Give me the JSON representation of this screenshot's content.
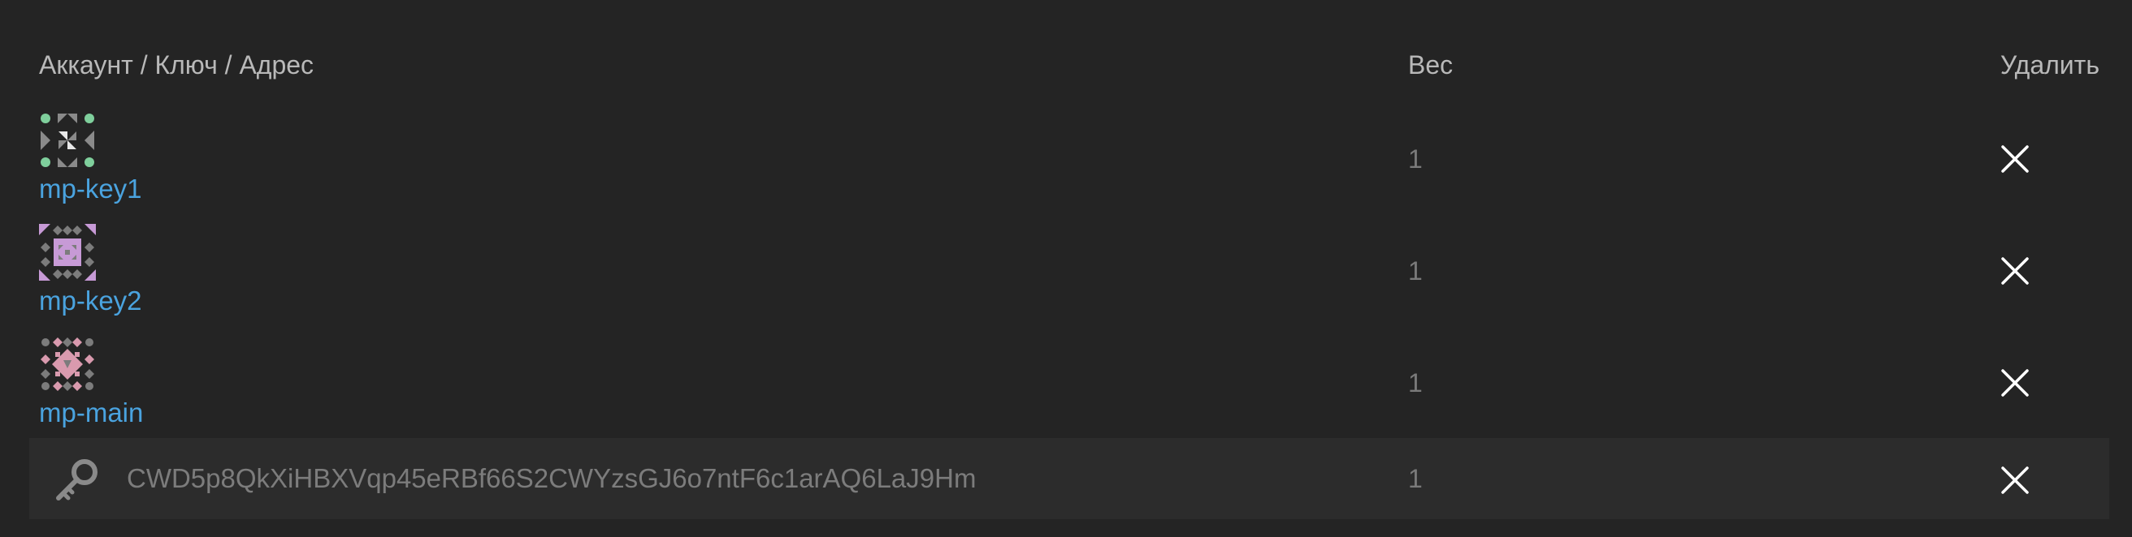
{
  "header": {
    "account_label": "Аккаунт / Ключ / Адрес",
    "weight_label": "Вес",
    "delete_label": "Удалить"
  },
  "accounts": [
    {
      "name": "mp-key1",
      "weight": "1",
      "avatar_icon": "identicon-green-gray"
    },
    {
      "name": "mp-key2",
      "weight": "1",
      "avatar_icon": "identicon-purple-gray"
    },
    {
      "name": "mp-main",
      "weight": "1",
      "avatar_icon": "identicon-pink-gray"
    }
  ],
  "key_entry": {
    "icon": "key-icon",
    "value": "CWD5p8QkXiHBXVqp45eRBf66S2CWYzsGJ6o7ntF6c1arAQ6LaJ9Hm",
    "weight": "1"
  },
  "colors": {
    "background": "#242424",
    "link": "#4aa3df",
    "header_text": "#b9b9b9",
    "muted_text": "#7a7a7a",
    "key_row_bg": "#2c2c2c"
  }
}
